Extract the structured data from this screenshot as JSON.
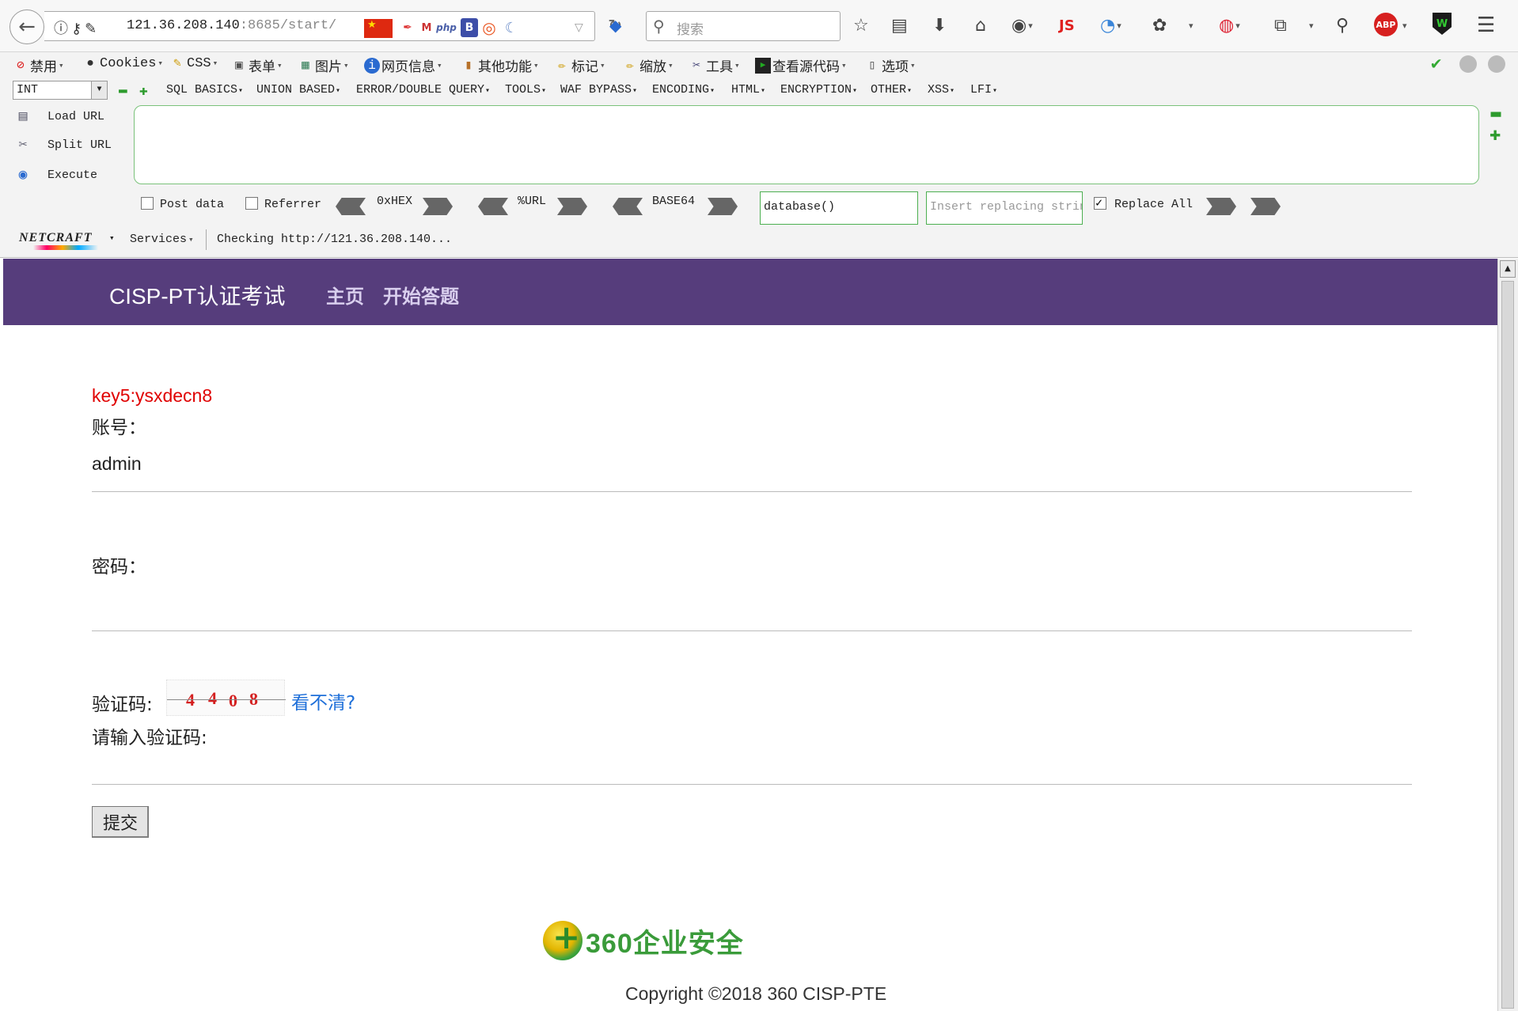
{
  "browser": {
    "url_host": "121.36.208.140",
    "url_port": ":8685",
    "url_path": "/start/",
    "search_placeholder": "搜索",
    "ext_js": "JS",
    "ext_abp": "ABP",
    "ext_w": "W"
  },
  "hackbar_menu": {
    "items": [
      "禁用",
      "Cookies",
      "CSS",
      "表单",
      "图片",
      "网页信息",
      "其他功能",
      "标记",
      "缩放",
      "工具",
      "查看源代码",
      "选项"
    ]
  },
  "hackbar": {
    "type_select": "INT",
    "menus": [
      "SQL BASICS",
      "UNION BASED",
      "ERROR/DOUBLE QUERY",
      "TOOLS",
      "WAF BYPASS",
      "ENCODING",
      "HTML",
      "ENCRYPTION",
      "OTHER",
      "XSS",
      "LFI"
    ],
    "load_url": "Load URL",
    "split_url": "Split URL",
    "execute": "Execute",
    "url_area_value": "",
    "post_data": "Post data",
    "referrer": "Referrer",
    "hex": "0xHEX",
    "urlenc": "%URL",
    "base64": "BASE64",
    "find_value": "database()",
    "replace_placeholder": "Insert replacing string",
    "replace_all": "Replace All",
    "post_checked": false,
    "referrer_checked": false,
    "replace_all_checked": true
  },
  "netcraft": {
    "logo": "NETCRAFT",
    "services": "Services",
    "status": "Checking http://121.36.208.140..."
  },
  "site": {
    "brand": "CISP-PT认证考试",
    "nav_home": "主页",
    "nav_start": "开始答题",
    "accent": "#563d7c"
  },
  "form": {
    "key": "key5:ysxdecn8",
    "account_label": "账号：",
    "account_value": "admin",
    "password_label": "密码：",
    "captcha_label": "验证码:",
    "captcha_chars": [
      "4",
      "4",
      "0",
      "8"
    ],
    "cant_see": "看不清?",
    "captcha_input_label": "请输入验证码:",
    "submit": "提交"
  },
  "footer": {
    "logo_text": "360企业安全",
    "copyright": "Copyright ©2018 360 CISP-PTE"
  }
}
